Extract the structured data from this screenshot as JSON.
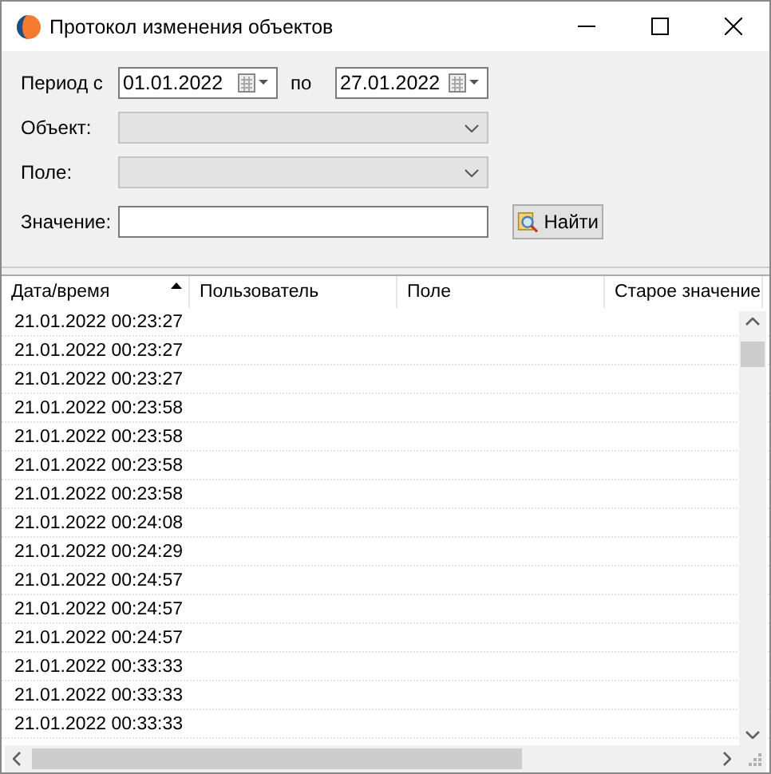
{
  "window": {
    "title": "Протокол изменения объектов"
  },
  "filter": {
    "period_label": "Период с",
    "date_from": "01.01.2022",
    "to_label": "по",
    "date_to": "27.01.2022",
    "object": {
      "label": "Объект:",
      "disabled": true
    },
    "field": {
      "label": "Поле:",
      "disabled": true
    },
    "value": {
      "label": "Значение:"
    },
    "search_button": "Найти"
  },
  "table": {
    "columns": [
      {
        "label": "Дата/время",
        "sorted": true
      },
      {
        "label": "Пользователь",
        "sorted": false
      },
      {
        "label": "Поле",
        "sorted": false
      },
      {
        "label": "Старое значение",
        "sorted": false
      }
    ],
    "rows": [
      [
        "21.01.2022 00:23:27"
      ],
      [
        "21.01.2022 00:23:27"
      ],
      [
        "21.01.2022 00:23:27"
      ],
      [
        "21.01.2022 00:23:58"
      ],
      [
        "21.01.2022 00:23:58"
      ],
      [
        "21.01.2022 00:23:58"
      ],
      [
        "21.01.2022 00:23:58"
      ],
      [
        "21.01.2022 00:24:08"
      ],
      [
        "21.01.2022 00:24:29"
      ],
      [
        "21.01.2022 00:24:57"
      ],
      [
        "21.01.2022 00:24:57"
      ],
      [
        "21.01.2022 00:24:57"
      ],
      [
        "21.01.2022 00:33:33"
      ],
      [
        "21.01.2022 00:33:33"
      ],
      [
        "21.01.2022 00:33:33"
      ]
    ]
  }
}
